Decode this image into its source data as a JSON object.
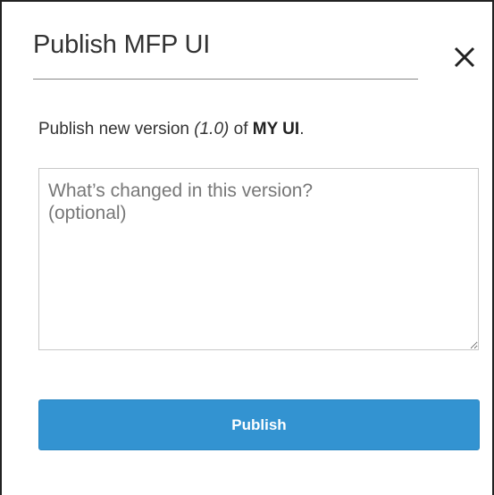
{
  "dialog": {
    "title": "Publish MFP UI",
    "close_icon": "close-icon",
    "description": {
      "prefix": "Publish new version ",
      "version": "(1.0)",
      "middle": " of ",
      "ui_name": "MY UI",
      "suffix": "."
    },
    "notes": {
      "value": "",
      "placeholder": "What’s changed in this version?\n(optional)"
    },
    "publish_label": "Publish",
    "colors": {
      "primary_button": "#3393d1",
      "button_text": "#ffffff",
      "text": "#333333"
    }
  }
}
